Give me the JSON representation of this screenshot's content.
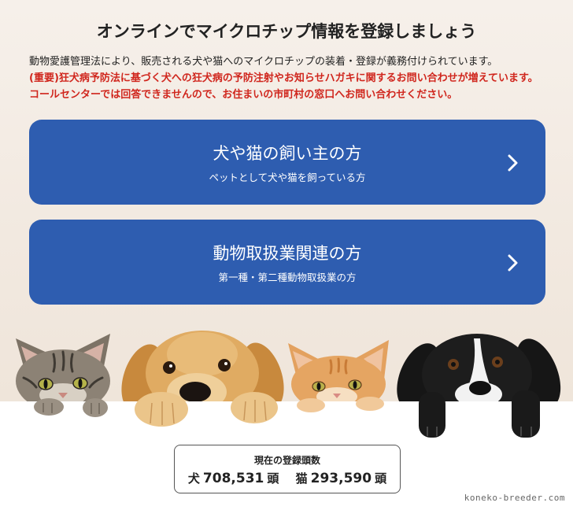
{
  "page": {
    "title": "オンラインでマイクロチップ情報を登録しましょう",
    "intro": "動物愛護管理法により、販売される犬や猫へのマイクロチップの装着・登録が義務付けられています。",
    "notice_lines": [
      "(重要)狂犬病予防法に基づく犬への狂犬病の予防注射やお知らせハガキに関するお問い合わせが増えています。",
      "コールセンターでは回答できませんので、お住まいの市町村の窓口へお問い合わせください。"
    ]
  },
  "options": [
    {
      "title": "犬や猫の飼い主の方",
      "subtitle": "ペットとして犬や猫を飼っている方",
      "icon": "chevron-right-icon"
    },
    {
      "title": "動物取扱業関連の方",
      "subtitle": "第一種・第二種動物取扱業の方",
      "icon": "chevron-right-icon"
    }
  ],
  "registration_count": {
    "label": "現在の登録頭数",
    "dog_label": "犬",
    "dog_count": "708,531",
    "cat_label": "猫",
    "cat_count": "293,590",
    "unit": "頭"
  },
  "watermark": "koneko-breeder.com",
  "colors": {
    "button": "#2e5db0",
    "notice": "#d0261d",
    "text": "#222222"
  }
}
